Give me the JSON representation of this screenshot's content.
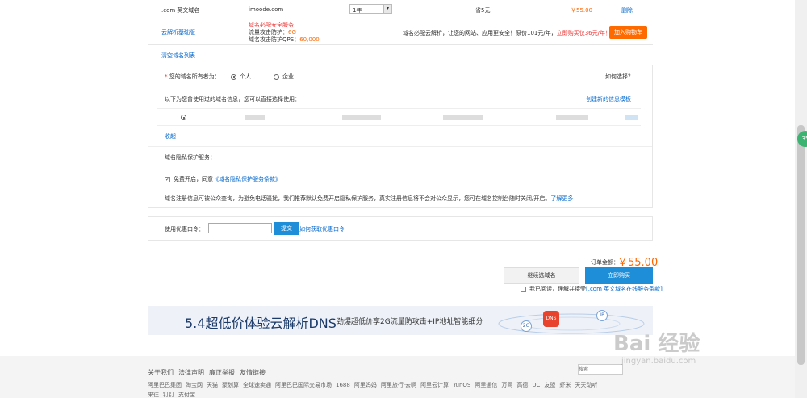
{
  "domain_row": {
    "type": ".com 英文域名",
    "name": "imoode.com",
    "period": "1年",
    "saving": "省5元",
    "price": "￥55.00",
    "delete": "删除"
  },
  "dns_row": {
    "title": "云解析基础版",
    "feature1": "域名必配安全服务",
    "feature2_label": "流量攻击防护：",
    "feature2_value": "6G",
    "feature3_label": "域名攻击防护QPS：",
    "feature3_value": "60,000",
    "promo_text": "域名必配云解析，让您的网站、应用更安全！原价101元/年，",
    "promo_link": "立即购买仅36元/年！",
    "add_cart": "加入购物车"
  },
  "clear_list": "清空域名列表",
  "owner": {
    "required_mark": "*",
    "label": "您的域名所有者为：",
    "option_personal": "个人",
    "option_company": "企业",
    "how_to_choose": "如何选择？",
    "template_hint": "以下为您曾使用过的域名信息，您可以直接选择使用：",
    "create_template": "创建新的信息模板",
    "collapse": "收起"
  },
  "privacy": {
    "title": "域名隐私保护服务：",
    "enable_text": "免费开启，同意",
    "terms_link": "《域名隐私保护服务条款》",
    "description": "域名注册信息可被公众查询，为避免电话骚扰，我们推荐默认免费开启隐私保护服务，真实注册信息将不会对公众显示，您可在域名控制台随时关闭/开启。",
    "learn_more": "了解更多"
  },
  "coupon": {
    "label": "使用优惠口令：",
    "input_value": "",
    "submit": "提交",
    "how_to_get": "如何获取优惠口令"
  },
  "order": {
    "total_label": "订单金额：",
    "total_value": "￥55.00",
    "continue_btn": "继续选域名",
    "buy_btn": "立即购买",
    "agree_text": "我已阅读，理解并接受",
    "agree_link": "[.com 英文域名在线服务条款]"
  },
  "banner": {
    "headline": "5.4超低价体验云解析DNS",
    "subline": "劲爆超低价享2G流量防攻击+IP地址智能细分",
    "badge_dns": "DNS",
    "badge_2g": "2G",
    "badge_ip": "IP"
  },
  "footer": {
    "links_row1": [
      "关于我们",
      "法律声明",
      "廉正举报",
      "友情链接"
    ],
    "links_row2": [
      "阿里巴巴集团",
      "淘宝网",
      "天猫",
      "聚划算",
      "全球速卖通",
      "阿里巴巴国际交易市场",
      "1688",
      "阿里妈妈",
      "阿里旅行·去啊",
      "阿里云计算",
      "YunOS",
      "阿里通信",
      "万网",
      "高德",
      "UC",
      "友盟",
      "虾米",
      "天天动听"
    ],
    "links_row3": [
      "来往",
      "钉钉",
      "支付宝"
    ],
    "search_placeholder": "搜索"
  },
  "float_badge": "35",
  "watermark": {
    "text": "Bai 经验",
    "url": "jingyan.baidu.com"
  }
}
